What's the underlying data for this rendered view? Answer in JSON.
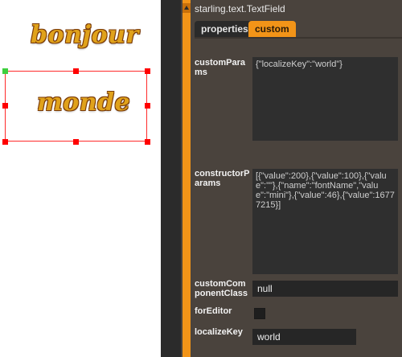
{
  "stage": {
    "text_top": "bonjour",
    "text_selected": "monde"
  },
  "inspector": {
    "class_name": "starling.text.TextField",
    "tabs": [
      {
        "label": "properties",
        "active": false
      },
      {
        "label": "custom",
        "active": true
      }
    ],
    "properties": {
      "custom_params": {
        "label": "customParams",
        "value": "{\"localizeKey\":\"world\"}"
      },
      "constructor_params": {
        "label": "constructorParams",
        "value": "[{\"value\":200},{\"value\":100},{\"value\":\"\"},{\"name\":\"fontName\",\"value\":\"mini\"},{\"value\":46},{\"value\":16777215}]"
      },
      "custom_component_class": {
        "label": "customComponentClass",
        "value": "null"
      },
      "for_editor": {
        "label": "forEditor",
        "checked": false
      },
      "localize_key": {
        "label": "localizeKey",
        "value": "world"
      }
    }
  },
  "colors": {
    "accent": "#f29418",
    "panel_bg": "#4a433d",
    "selection": "#ff0000"
  }
}
